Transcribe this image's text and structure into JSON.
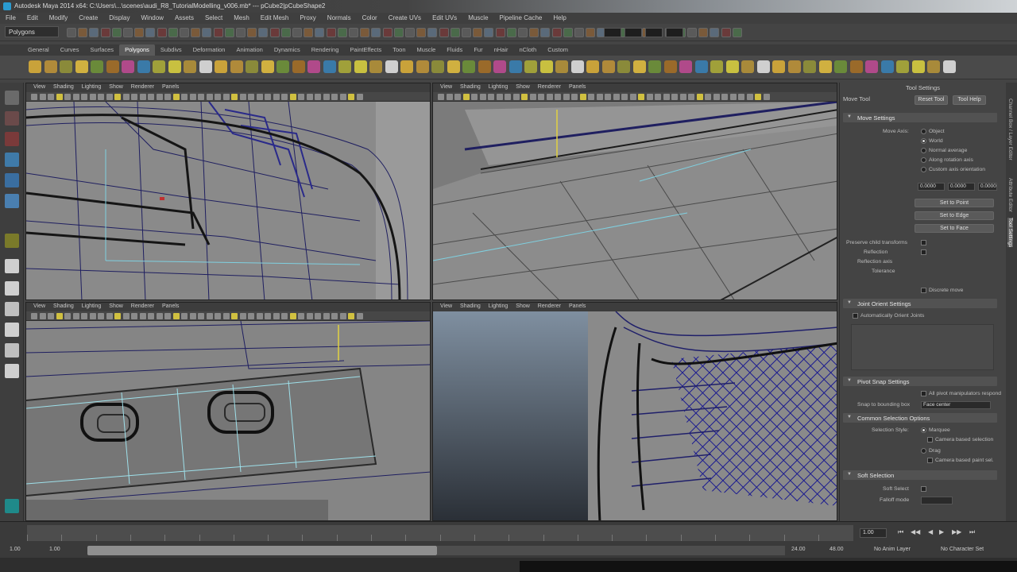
{
  "window": {
    "title": "Autodesk Maya 2014 x64: C:\\Users\\...\\scenes\\audi_R8_TutorialModelling_v006.mb* --- pCube2|pCubeShape2"
  },
  "menubar": [
    "File",
    "Edit",
    "Modify",
    "Create",
    "Display",
    "Window",
    "Assets",
    "Select",
    "Mesh",
    "Edit Mesh",
    "Proxy",
    "Normals",
    "Color",
    "Create UVs",
    "Edit UVs",
    "Muscle",
    "Pipeline Cache",
    "Help"
  ],
  "statusline": {
    "mode": "Polygons"
  },
  "shelf_tabs": {
    "items": [
      "General",
      "Curves",
      "Surfaces",
      "Polygons",
      "Subdivs",
      "Deformation",
      "Animation",
      "Dynamics",
      "Rendering",
      "PaintEffects",
      "Toon",
      "Muscle",
      "Fluids",
      "Fur",
      "nHair",
      "nCloth",
      "Custom"
    ],
    "active": "Polygons"
  },
  "panel_menu": [
    "View",
    "Shading",
    "Lighting",
    "Show",
    "Renderer",
    "Panels"
  ],
  "tool_settings": {
    "header": "Tool Settings",
    "tool_name": "Move Tool",
    "reset_label": "Reset Tool",
    "help_label": "Tool Help",
    "move_settings": {
      "title": "Move Settings",
      "move_axis_label": "Move Axis:",
      "axis_options": [
        "Object",
        "World",
        "Normal average",
        "Along rotation axis",
        "Custom axis orientation"
      ],
      "selected_axis": "World",
      "values": [
        "0.0000",
        "0.0000",
        "0.0000"
      ],
      "buttons": [
        "Set to Point",
        "Set to Edge",
        "Set to Face"
      ],
      "options": [
        "Preserve child transforms",
        "Reflection",
        "Reflection axis",
        "Tolerance",
        "Discrete move"
      ],
      "discrete_label": "Discrete move"
    },
    "joint_orient": {
      "title": "Joint Orient Settings",
      "auto_orient_label": "Automatically Orient Joints"
    },
    "pivot_snap": {
      "title": "Pivot Snap Settings",
      "edit_pivot_label": "All pivot manipulators respond",
      "snap_label": "Snap to bounding box",
      "snap_value": "Face center"
    },
    "common_selection": {
      "title": "Common Selection Options",
      "selection_style_label": "Selection Style:",
      "style_options": [
        "Marquee",
        "Drag"
      ],
      "camera_based_label": "Camera based selection",
      "camera_based_label2": "Camera based paint sel."
    },
    "soft_selection": {
      "title": "Soft Selection",
      "soft_select_label": "Soft Select",
      "falloff_label": "Falloff mode"
    }
  },
  "side_tabs": [
    "Channel Box / Layer Editor",
    "Attribute Editor",
    "Tool Settings"
  ],
  "active_side_tab": "Tool Settings",
  "timeslider": {
    "current_frame": "1.00",
    "start": "1.00",
    "end": "24.00",
    "range_start": "1.00",
    "range_end": "24.00",
    "anim_end": "48.00",
    "anim_layer": "No Anim Layer",
    "char_set": "No Character Set"
  }
}
